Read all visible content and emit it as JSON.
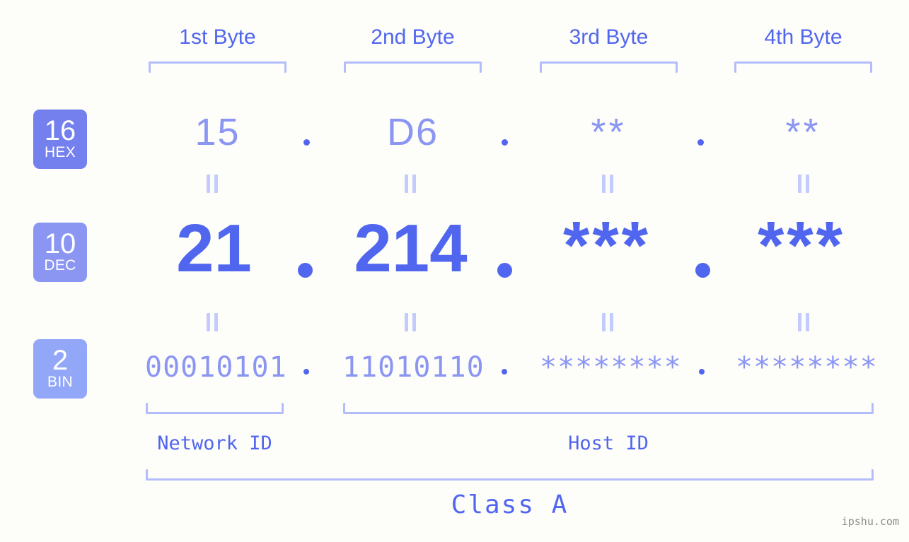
{
  "background_color": "#fdfdfa",
  "accent_color": "#5166ef",
  "accent_light": "#8b96f2",
  "bracket_color": "#b4bdfb",
  "headers": {
    "byte1": "1st Byte",
    "byte2": "2nd Byte",
    "byte3": "3rd Byte",
    "byte4": "4th Byte"
  },
  "rows": {
    "hex": {
      "badge_number": "16",
      "badge_name": "HEX",
      "badge_color": "#7380ed",
      "values": [
        "15",
        "D6",
        "**",
        "**"
      ],
      "separators": [
        ".",
        ".",
        "."
      ]
    },
    "dec": {
      "badge_number": "10",
      "badge_name": "DEC",
      "badge_color": "#8b96f2",
      "values": [
        "21",
        "214",
        "***",
        "***"
      ],
      "separators": [
        ".",
        ".",
        "."
      ]
    },
    "bin": {
      "badge_number": "2",
      "badge_name": "BIN",
      "badge_color": "#93a7f9",
      "values": [
        "00010101",
        "11010110",
        "********",
        "********"
      ],
      "separators": [
        ".",
        ".",
        "."
      ]
    }
  },
  "equals_marks": {
    "symbol": "||",
    "count_per_row": 4
  },
  "groups": {
    "network_id": "Network ID",
    "host_id": "Host ID",
    "class": "Class A"
  },
  "watermark": "ipshu.com"
}
